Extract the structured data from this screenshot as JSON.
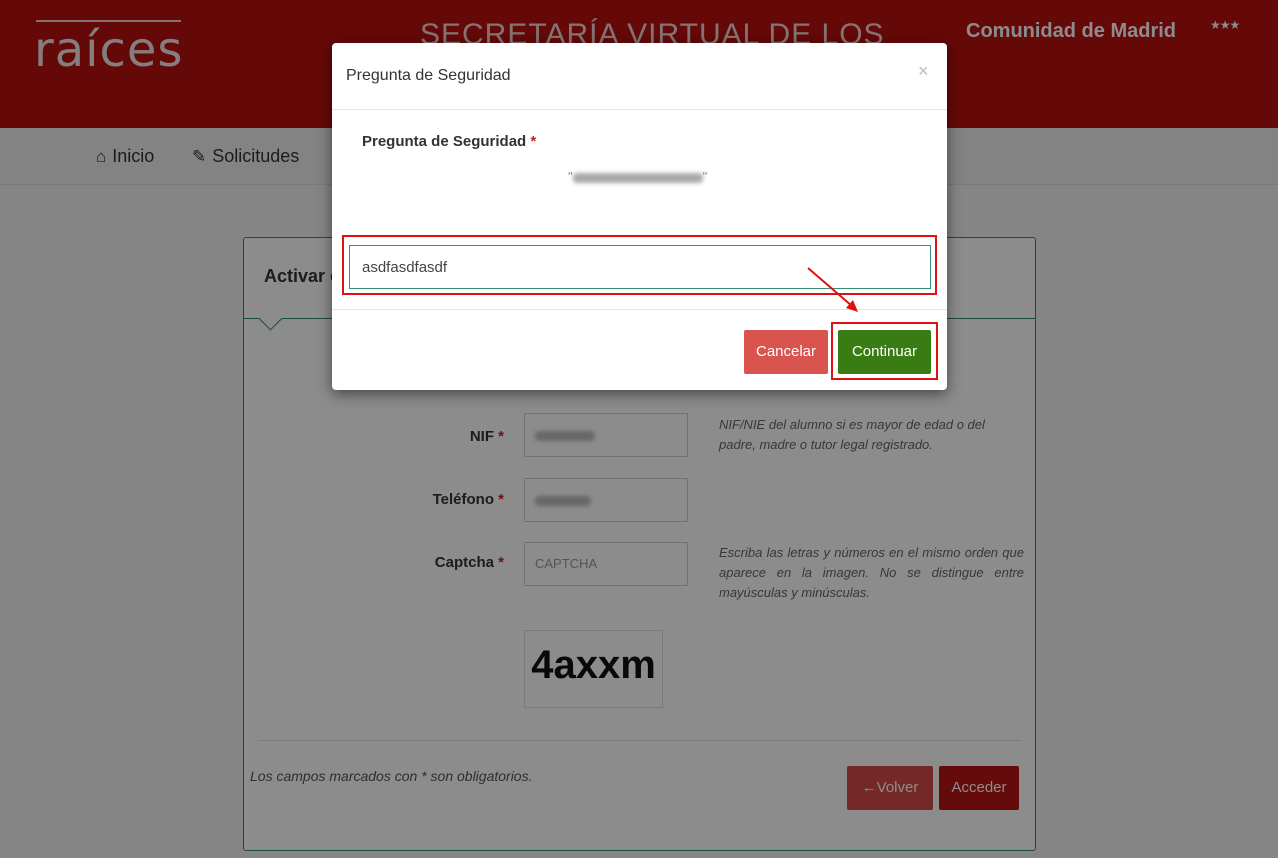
{
  "header": {
    "logo": "raíces",
    "title": "SECRETARÍA VIRTUAL DE LOS",
    "community": "Comunidad de Madrid",
    "stars": "★★★"
  },
  "nav": {
    "items": [
      {
        "icon": "home-icon",
        "label": "Inicio"
      },
      {
        "icon": "pencil-icon",
        "label": "Solicitudes"
      }
    ]
  },
  "panel": {
    "title": "Activar c",
    "fields": [
      {
        "label": "NIF",
        "required": "*",
        "placeholder": "",
        "help": "NIF/NIE del alumno si es mayor de edad o del padre, madre o tutor legal registrado."
      },
      {
        "label": "Teléfono",
        "required": "*",
        "placeholder": "",
        "help": ""
      },
      {
        "label": "Captcha",
        "required": "*",
        "placeholder": "CAPTCHA",
        "help": "Escriba las letras y números en el mismo orden que aparece en la imagen. No se distingue entre mayúsculas y minúsculas."
      }
    ],
    "captcha_image_text": "4axxm",
    "required_note": "Los campos marcados con * son obligatorios.",
    "back_label": "Volver",
    "submit_label": "Acceder"
  },
  "modal": {
    "title": "Pregunta de Seguridad",
    "close": "×",
    "question_label": "Pregunta de Seguridad",
    "required": "*",
    "answer_value": "asdfasdfasdf",
    "cancel_label": "Cancelar",
    "continue_label": "Continuar"
  },
  "colors": {
    "header_red": "#b80f0f",
    "continue_green": "#3a7c14",
    "cancel_red": "#d9534f",
    "annotation_red": "#dd1111"
  }
}
